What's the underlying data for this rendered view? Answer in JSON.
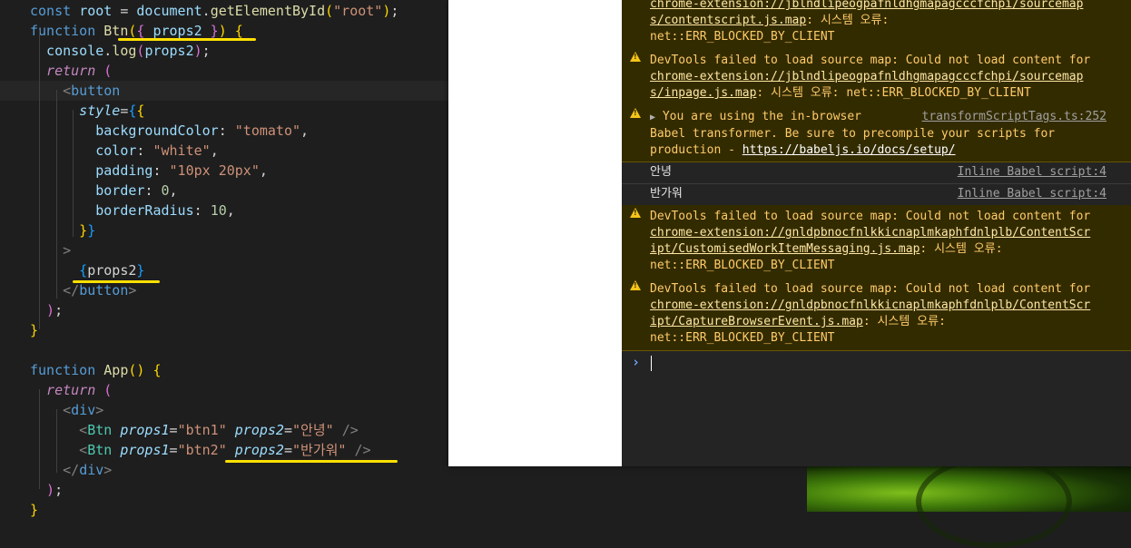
{
  "code_lines": [
    [
      [
        "const ",
        "t-kw"
      ],
      [
        "root",
        "t-var"
      ],
      [
        " = ",
        "t-pl"
      ],
      [
        "document",
        "t-var"
      ],
      [
        ".",
        "t-pl"
      ],
      [
        "getElementById",
        "t-fn"
      ],
      [
        "(",
        "t-br1"
      ],
      [
        "\"root\"",
        "t-str"
      ],
      [
        ")",
        "t-br1"
      ],
      [
        ";",
        "t-pl"
      ]
    ],
    [
      [
        "function ",
        "t-kw"
      ],
      [
        "Btn",
        "t-fn"
      ],
      [
        "(",
        "t-br1"
      ],
      [
        "{ ",
        "t-br2"
      ],
      [
        "props2",
        "t-var"
      ],
      [
        " }",
        "t-br2"
      ],
      [
        ")",
        "t-br1"
      ],
      [
        " ",
        "t-pl"
      ],
      [
        "{",
        "t-br1"
      ]
    ],
    [
      [
        "  console",
        "t-var"
      ],
      [
        ".",
        "t-pl"
      ],
      [
        "log",
        "t-fn"
      ],
      [
        "(",
        "t-br2"
      ],
      [
        "props2",
        "t-var"
      ],
      [
        ")",
        "t-br2"
      ],
      [
        ";",
        "t-pl"
      ]
    ],
    [
      [
        "  return",
        "t-ctl"
      ],
      [
        " ",
        "t-pl"
      ],
      [
        "(",
        "t-br2"
      ]
    ],
    [
      [
        "    <",
        "t-gray"
      ],
      [
        "button",
        "t-tag"
      ]
    ],
    [
      [
        "      style",
        "t-attr"
      ],
      [
        "=",
        "t-pl"
      ],
      [
        "{",
        "t-br3"
      ],
      [
        "{",
        "t-br1"
      ]
    ],
    [
      [
        "        backgroundColor",
        "t-var"
      ],
      [
        ": ",
        "t-pl"
      ],
      [
        "\"tomato\"",
        "t-str"
      ],
      [
        ",",
        "t-pl"
      ]
    ],
    [
      [
        "        color",
        "t-var"
      ],
      [
        ": ",
        "t-pl"
      ],
      [
        "\"white\"",
        "t-str"
      ],
      [
        ",",
        "t-pl"
      ]
    ],
    [
      [
        "        padding",
        "t-var"
      ],
      [
        ": ",
        "t-pl"
      ],
      [
        "\"10px 20px\"",
        "t-str"
      ],
      [
        ",",
        "t-pl"
      ]
    ],
    [
      [
        "        border",
        "t-var"
      ],
      [
        ": ",
        "t-pl"
      ],
      [
        "0",
        "t-num"
      ],
      [
        ",",
        "t-pl"
      ]
    ],
    [
      [
        "        borderRadius",
        "t-var"
      ],
      [
        ": ",
        "t-pl"
      ],
      [
        "10",
        "t-num"
      ],
      [
        ",",
        "t-pl"
      ]
    ],
    [
      [
        "      }",
        "t-br1"
      ],
      [
        "}",
        "t-br3"
      ]
    ],
    [
      [
        "    >",
        "t-gray"
      ]
    ],
    [
      [
        "      {",
        "t-br3"
      ],
      [
        "props2",
        "t-pl"
      ],
      [
        "}",
        "t-br3"
      ]
    ],
    [
      [
        "    </",
        "t-gray"
      ],
      [
        "button",
        "t-tag"
      ],
      [
        ">",
        "t-gray"
      ]
    ],
    [
      [
        "  )",
        "t-br2"
      ],
      [
        ";",
        "t-pl"
      ]
    ],
    [
      [
        "}",
        "t-br1"
      ]
    ],
    [],
    [
      [
        "function ",
        "t-kw"
      ],
      [
        "App",
        "t-fn"
      ],
      [
        "(",
        "t-br1"
      ],
      [
        ")",
        "t-br1"
      ],
      [
        " ",
        "t-pl"
      ],
      [
        "{",
        "t-br1"
      ]
    ],
    [
      [
        "  return",
        "t-ctl"
      ],
      [
        " ",
        "t-pl"
      ],
      [
        "(",
        "t-br2"
      ]
    ],
    [
      [
        "    <",
        "t-gray"
      ],
      [
        "div",
        "t-tag"
      ],
      [
        ">",
        "t-gray"
      ]
    ],
    [
      [
        "      <",
        "t-gray"
      ],
      [
        "Btn",
        "t-comp"
      ],
      [
        " ",
        "t-pl"
      ],
      [
        "props1",
        "t-attr"
      ],
      [
        "=",
        "t-pl"
      ],
      [
        "\"btn1\"",
        "t-str"
      ],
      [
        " ",
        "t-pl"
      ],
      [
        "props2",
        "t-attr"
      ],
      [
        "=",
        "t-pl"
      ],
      [
        "\"안녕\"",
        "t-str"
      ],
      [
        " />",
        "t-gray"
      ]
    ],
    [
      [
        "      <",
        "t-gray"
      ],
      [
        "Btn",
        "t-comp"
      ],
      [
        " ",
        "t-pl"
      ],
      [
        "props1",
        "t-attr"
      ],
      [
        "=",
        "t-pl"
      ],
      [
        "\"btn2\"",
        "t-str"
      ],
      [
        " ",
        "t-pl"
      ],
      [
        "props2",
        "t-attr"
      ],
      [
        "=",
        "t-pl"
      ],
      [
        "\"반가워\"",
        "t-str"
      ],
      [
        " />",
        "t-gray"
      ]
    ],
    [
      [
        "    </",
        "t-gray"
      ],
      [
        "div",
        "t-tag"
      ],
      [
        ">",
        "t-gray"
      ]
    ],
    [
      [
        "  )",
        "t-br2"
      ],
      [
        ";",
        "t-pl"
      ]
    ],
    [
      [
        "}",
        "t-br1"
      ]
    ]
  ],
  "console": {
    "messages": [
      {
        "level": "warning",
        "parts": [
          [
            [
              "chrome-extension://jblndlipeogpafnldhgmapagcccfchpi/sourcemap",
              "lnk-w"
            ]
          ],
          [
            [
              "s/contentscript.js.map",
              "lnk-w"
            ],
            [
              ": 시스템 오류:",
              ""
            ]
          ],
          [
            [
              "net::ERR_BLOCKED_BY_CLIENT",
              ""
            ]
          ]
        ]
      },
      {
        "level": "warning",
        "parts": [
          [
            [
              "DevTools failed to load source map: Could not load content for",
              ""
            ]
          ],
          [
            [
              "chrome-extension://jblndlipeogpafnldhgmapagcccfchpi/sourcemap",
              "lnk-w"
            ]
          ],
          [
            [
              "s/inpage.js.map",
              "lnk-w"
            ],
            [
              ": 시스템 오류: net::ERR_BLOCKED_BY_CLIENT",
              ""
            ]
          ]
        ]
      },
      {
        "level": "warning",
        "source": "transformScriptTags.ts:252",
        "parts": [
          [
            [
              "▶",
              "tri"
            ],
            [
              " You are using the in-browser",
              ""
            ]
          ],
          [
            [
              "Babel transformer. Be sure to precompile your scripts for",
              ""
            ]
          ],
          [
            [
              "production - ",
              ""
            ],
            [
              "https://babeljs.io/docs/setup/",
              "lnk"
            ]
          ]
        ]
      },
      {
        "level": "log",
        "source": "Inline Babel script:4",
        "parts": [
          [
            [
              "안녕",
              ""
            ]
          ]
        ]
      },
      {
        "level": "log",
        "source": "Inline Babel script:4",
        "parts": [
          [
            [
              "반가워",
              ""
            ]
          ]
        ]
      },
      {
        "level": "warning",
        "parts": [
          [
            [
              "DevTools failed to load source map: Could not load content for",
              ""
            ]
          ],
          [
            [
              "chrome-extension://gnldpbnocfnlkkicnaplmkaphfdnlplb/ContentScr",
              "lnk-w"
            ]
          ],
          [
            [
              "ipt/CustomisedWorkItemMessaging.js.map",
              "lnk-w"
            ],
            [
              ": 시스템 오류:",
              ""
            ]
          ],
          [
            [
              "net::ERR_BLOCKED_BY_CLIENT",
              ""
            ]
          ]
        ]
      },
      {
        "level": "warning",
        "parts": [
          [
            [
              "DevTools failed to load source map: Could not load content for",
              ""
            ]
          ],
          [
            [
              "chrome-extension://gnldpbnocfnlkkicnaplmkaphfdnlplb/ContentScr",
              "lnk-w"
            ]
          ],
          [
            [
              "ipt/CaptureBrowserEvent.js.map",
              "lnk-w"
            ],
            [
              ": 시스템 오류:",
              ""
            ]
          ],
          [
            [
              "net::ERR_BLOCKED_BY_CLIENT",
              ""
            ]
          ]
        ]
      }
    ],
    "prompt_symbol": "›"
  }
}
